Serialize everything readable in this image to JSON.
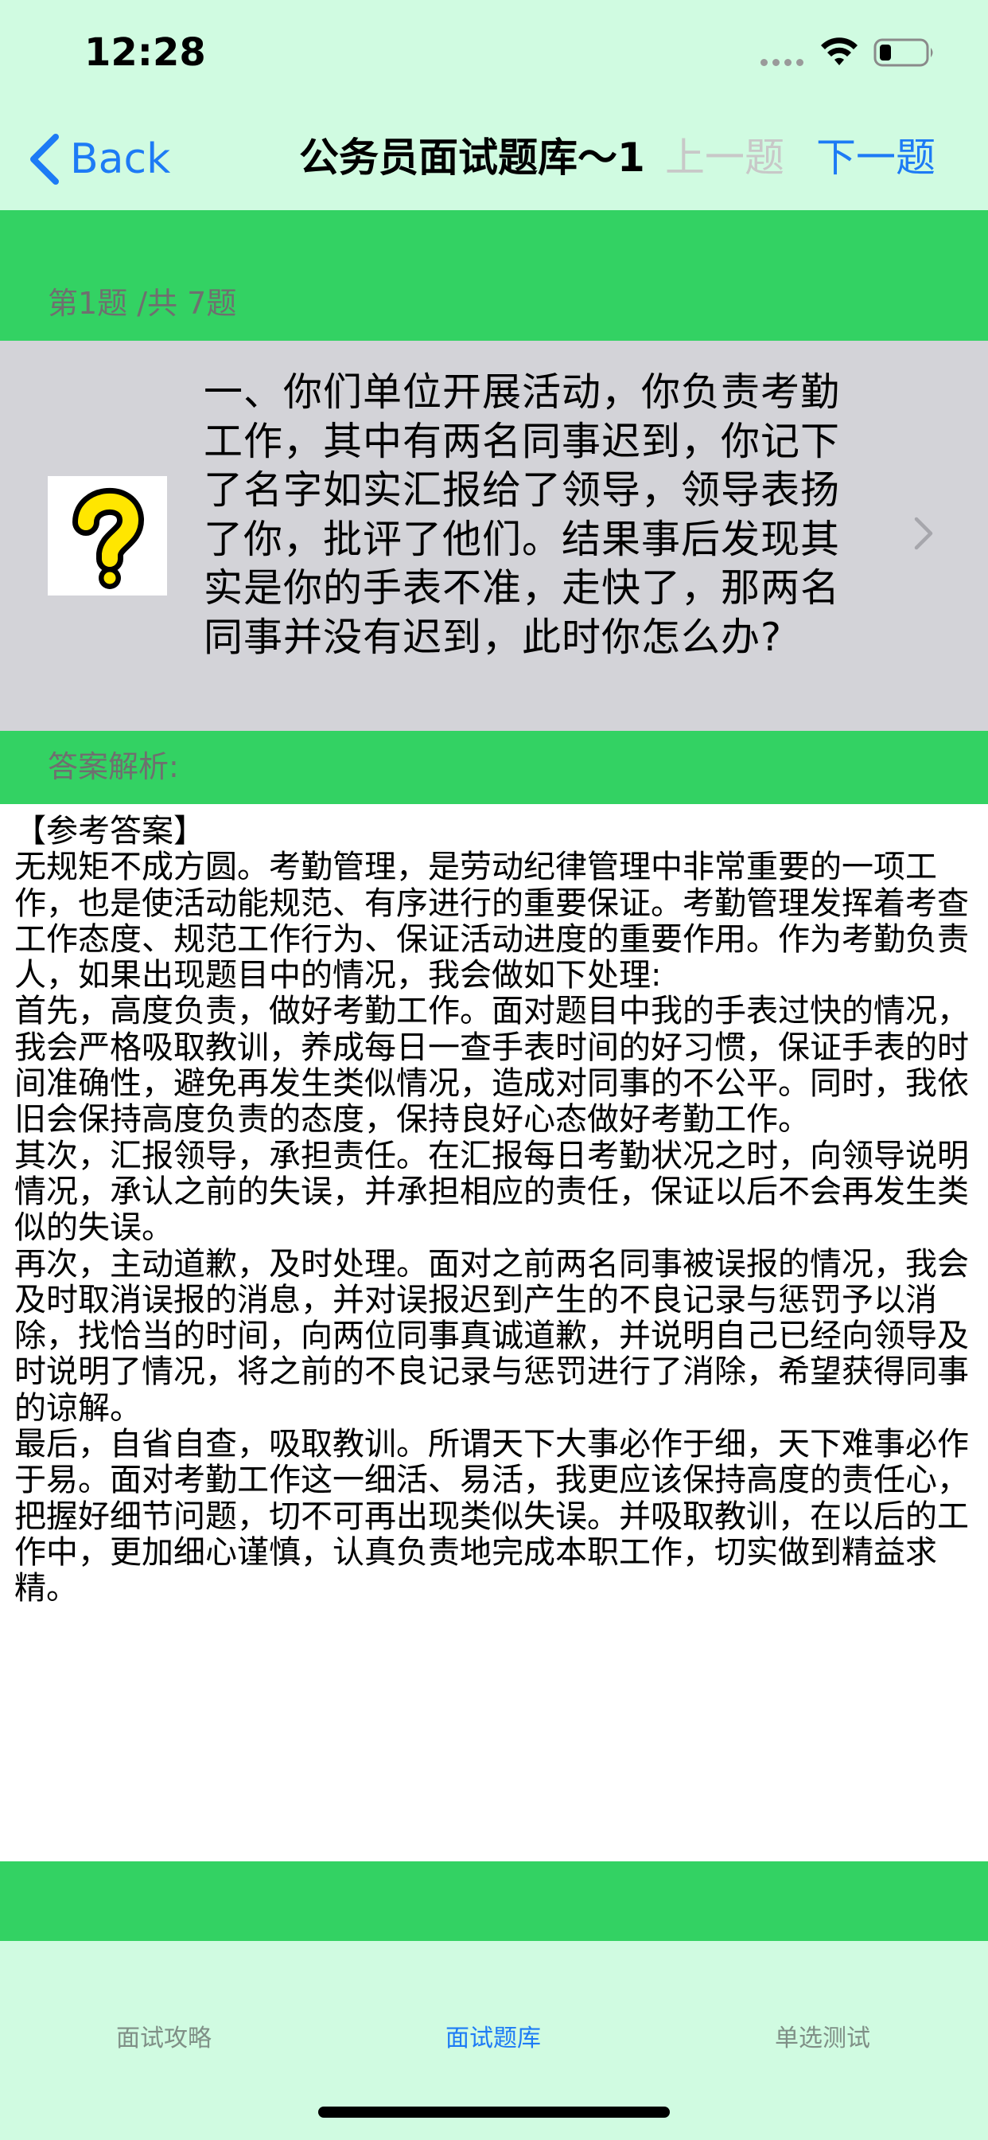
{
  "status_bar": {
    "time": "12:28"
  },
  "nav": {
    "back_label": "Back",
    "title": "公务员面试题库～1",
    "prev_label": "上一题",
    "next_label": "下一题"
  },
  "question": {
    "counter": "第1题 /共 7题",
    "image_icon": "question-mark-icon",
    "text": "一、你们单位开展活动，你负责考勤工作，其中有两名同事迟到，你记下了名字如实汇报给了领导，领导表扬了你，批评了他们。结果事后发现其实是你的手表不准，走快了，那两名同事并没有迟到，此时你怎么办?"
  },
  "answer": {
    "header": "答案解析:",
    "text": "【参考答案】\n无规矩不成方圆。考勤管理，是劳动纪律管理中非常重要的一项工作，也是使活动能规范、有序进行的重要保证。考勤管理发挥着考查工作态度、规范工作行为、保证活动进度的重要作用。作为考勤负责人，如果出现题目中的情况，我会做如下处理:\n首先，高度负责，做好考勤工作。面对题目中我的手表过快的情况，我会严格吸取教训，养成每日一查手表时间的好习惯，保证手表的时间准确性，避免再发生类似情况，造成对同事的不公平。同时，我依旧会保持高度负责的态度，保持良好心态做好考勤工作。\n其次，汇报领导，承担责任。在汇报每日考勤状况之时，向领导说明情况，承认之前的失误，并承担相应的责任，保证以后不会再发生类似的失误。\n再次，主动道歉，及时处理。面对之前两名同事被误报的情况，我会及时取消误报的消息，并对误报迟到产生的不良记录与惩罚予以消除，找恰当的时间，向两位同事真诚道歉，并说明自己已经向领导及时说明了情况，将之前的不良记录与惩罚进行了消除，希望获得同事的谅解。\n最后，自省自查，吸取教训。所谓天下大事必作于细，天下难事必作于易。面对考勤工作这一细活、易活，我更应该保持高度的责任心，把握好细节问题，切不可再出现类似失误。并吸取教训，在以后的工作中，更加细心谨慎，认真负责地完成本职工作，切实做到精益求精。"
  },
  "tabs": [
    {
      "label": "面试攻略",
      "selected": false
    },
    {
      "label": "面试题库",
      "selected": true
    },
    {
      "label": "单选测试",
      "selected": false
    }
  ],
  "colors": {
    "mint_background": "#d0fbe1",
    "green_band": "#33d263",
    "question_cell": "#d3d3d8",
    "accent_blue": "#1d7bf5",
    "disabled_gray": "#c8c8c8"
  }
}
